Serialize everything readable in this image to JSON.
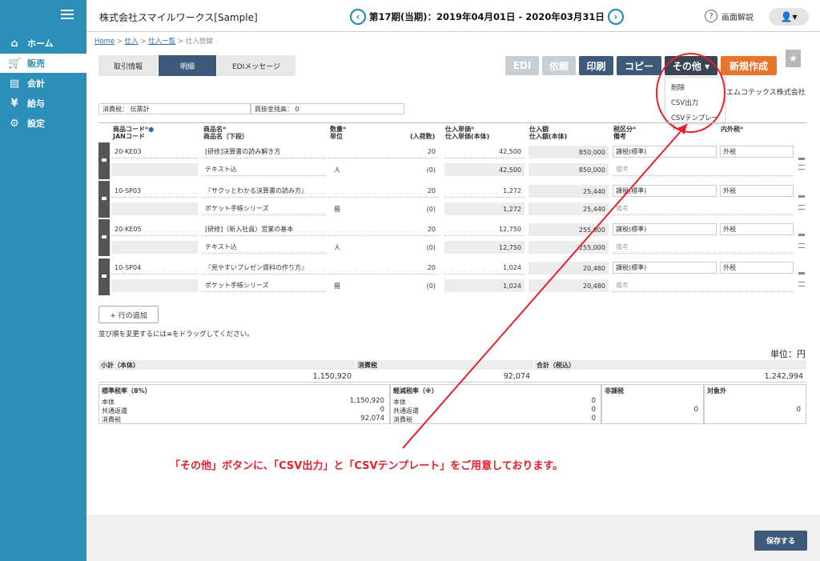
{
  "sidebar": {
    "items": [
      {
        "label": "ホーム",
        "icon": "home-icon",
        "glyph": "⌂"
      },
      {
        "label": "販売",
        "icon": "cart-icon",
        "glyph": "🛒"
      },
      {
        "label": "会計",
        "icon": "calculator-icon",
        "glyph": "▤"
      },
      {
        "label": "給与",
        "icon": "money-bag-icon",
        "glyph": "¥"
      },
      {
        "label": "設定",
        "icon": "gear-icon",
        "glyph": "⚙"
      }
    ]
  },
  "header": {
    "company": "株式会社スマイルワークス[Sample]",
    "period": "第17期(当期)：2019年04月01日 - 2020年03月31日",
    "help": "画面解説"
  },
  "breadcrumb": {
    "home": "Home",
    "sep": " > ",
    "purchase": "仕入",
    "list": "仕入一覧",
    "current": "仕入登録"
  },
  "tabs": [
    {
      "label": "取引情報"
    },
    {
      "label": "明細"
    },
    {
      "label": "EDIメッセージ"
    }
  ],
  "actions": {
    "edi": "EDI",
    "request": "依頼",
    "print": "印刷",
    "copy": "コピー",
    "other": "その他 ▾",
    "new": "新規作成"
  },
  "dropdown": {
    "items": [
      "削除",
      "CSV出力",
      "CSVテンプレート"
    ]
  },
  "supplier": "エムコテックス株式会社",
  "tax_info": {
    "tax_label": "消費税：",
    "tax_value": "伝票計",
    "balance_label": "買掛金残高：",
    "balance_value": "0"
  },
  "table": {
    "headers": {
      "code": "商品コード",
      "jan": "JANコード",
      "name": "商品名",
      "name_lower": "商品名（下段）",
      "qty": "数量",
      "unit": "単位",
      "carton": "(入荷数)",
      "price": "仕入単価",
      "price_body": "仕入単価(本体)",
      "amount": "仕入額",
      "amount_body": "仕入額(本体)",
      "taxcat": "税区分",
      "note": "備考",
      "inout": "内外税"
    },
    "rows": [
      {
        "code": "20-KE03",
        "name": "[研修]決算書の読み解き方",
        "name2": "テキスト込",
        "unit": "人",
        "qty": "20",
        "carton": "(0)",
        "price": "42,500",
        "price2": "42,500",
        "amount": "850,000",
        "amount2": "850,000",
        "taxcat": "課税(標準)",
        "inout": "外税",
        "note": "備考"
      },
      {
        "code": "10-SP03",
        "name": "『サクッとわかる決算書の読み方』",
        "name2": "ポケット手帳シリーズ",
        "unit": "冊",
        "qty": "20",
        "carton": "(0)",
        "price": "1,272",
        "price2": "1,272",
        "amount": "25,440",
        "amount2": "25,440",
        "taxcat": "課税(標準)",
        "inout": "外税",
        "note": "備考"
      },
      {
        "code": "20-KE05",
        "name": "[研修]（新入社員）営業の基本",
        "name2": "テキスト込",
        "unit": "人",
        "qty": "20",
        "carton": "(0)",
        "price": "12,750",
        "price2": "12,750",
        "amount": "255,000",
        "amount2": "255,000",
        "taxcat": "課税(標準)",
        "inout": "外税",
        "note": "備考"
      },
      {
        "code": "10-SP04",
        "name": "『見やすいプレゼン資料の作り方』",
        "name2": "ポケット手帳シリーズ",
        "unit": "冊",
        "qty": "20",
        "carton": "(0)",
        "price": "1,024",
        "price2": "1,024",
        "amount": "20,480",
        "amount2": "20,480",
        "taxcat": "課税(標準)",
        "inout": "外税",
        "note": "備考"
      }
    ]
  },
  "add_row": "+ 行の追加",
  "drag_hint": "並び順を変更するには≡をドラッグしてください。",
  "unit_label": "単位：円",
  "summary": {
    "subtotal_label": "小計（本体）",
    "subtotal": "1,150,920",
    "tax_label": "消費税",
    "tax": "92,074",
    "total_label": "合計（税込）",
    "total": "1,242,994"
  },
  "tax_breakdown": {
    "standard": {
      "title": "標準税率（8%）",
      "body_label": "本体",
      "body": "1,150,920",
      "common_label": "共通返還",
      "common": "0",
      "tax_label": "消費税",
      "tax": "92,074"
    },
    "reduced": {
      "title": "軽減税率（※）",
      "body_label": "本体",
      "body": "0",
      "common_label": "共通返還",
      "common": "0",
      "tax_label": "消費税",
      "tax": "0"
    },
    "nontax": {
      "title": "非課税",
      "value": "0"
    },
    "exempt": {
      "title": "対象外",
      "value": "0"
    }
  },
  "annotation": "「その他」ボタンに、「CSV出力」と「CSVテンプレート」をご用意しております。",
  "footer": {
    "save": "保存する"
  },
  "colors": {
    "sidebar": "#2b8fb8",
    "primary": "#3d5a7a",
    "accent": "#e8732a",
    "annotation": "#e5202a"
  }
}
